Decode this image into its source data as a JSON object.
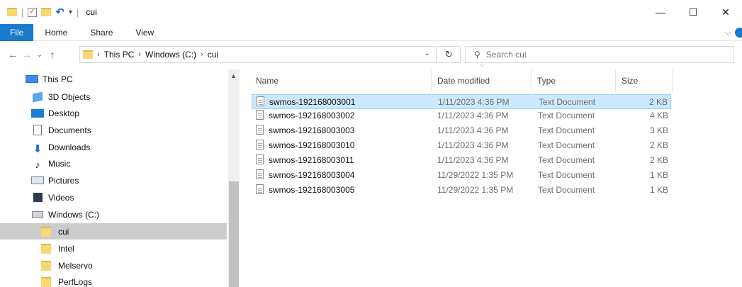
{
  "window": {
    "title": "cui",
    "minimize_glyph": "—",
    "maximize_glyph": "☐",
    "close_glyph": "✕"
  },
  "ribbon": {
    "tabs": [
      "File",
      "Home",
      "Share",
      "View"
    ]
  },
  "address": {
    "crumbs": [
      "This PC",
      "Windows (C:)",
      "cui"
    ]
  },
  "search": {
    "placeholder": "Search cui"
  },
  "nav": {
    "items": [
      {
        "label": "This PC",
        "icon": "monitor-icon"
      },
      {
        "label": "3D Objects",
        "icon": "cube-icon"
      },
      {
        "label": "Desktop",
        "icon": "desktop-icon"
      },
      {
        "label": "Documents",
        "icon": "documents-icon"
      },
      {
        "label": "Downloads",
        "icon": "download-arrow-icon"
      },
      {
        "label": "Music",
        "icon": "music-note-icon"
      },
      {
        "label": "Pictures",
        "icon": "pictures-icon"
      },
      {
        "label": "Videos",
        "icon": "videos-icon"
      },
      {
        "label": "Windows (C:)",
        "icon": "drive-icon"
      },
      {
        "label": "cui",
        "icon": "folder-icon",
        "selected": true
      },
      {
        "label": "Intel",
        "icon": "folder-icon"
      },
      {
        "label": "Melservo",
        "icon": "folder-icon"
      },
      {
        "label": "PerfLogs",
        "icon": "folder-icon"
      }
    ]
  },
  "columns": [
    "Name",
    "Date modified",
    "Type",
    "Size"
  ],
  "files": [
    {
      "name": "swmos-192168003001",
      "date": "1/11/2023 4:36 PM",
      "type": "Text Document",
      "size": "2 KB",
      "selected": true
    },
    {
      "name": "swmos-192168003002",
      "date": "1/11/2023 4:36 PM",
      "type": "Text Document",
      "size": "4 KB"
    },
    {
      "name": "swmos-192168003003",
      "date": "1/11/2023 4:36 PM",
      "type": "Text Document",
      "size": "3 KB"
    },
    {
      "name": "swmos-192168003010",
      "date": "1/11/2023 4:36 PM",
      "type": "Text Document",
      "size": "2 KB"
    },
    {
      "name": "swmos-192168003011",
      "date": "1/11/2023 4:36 PM",
      "type": "Text Document",
      "size": "2 KB"
    },
    {
      "name": "swmos-192168003004",
      "date": "11/29/2022 1:35 PM",
      "type": "Text Document",
      "size": "1 KB"
    },
    {
      "name": "swmos-192168003005",
      "date": "11/29/2022 1:35 PM",
      "type": "Text Document",
      "size": "1 KB"
    }
  ]
}
